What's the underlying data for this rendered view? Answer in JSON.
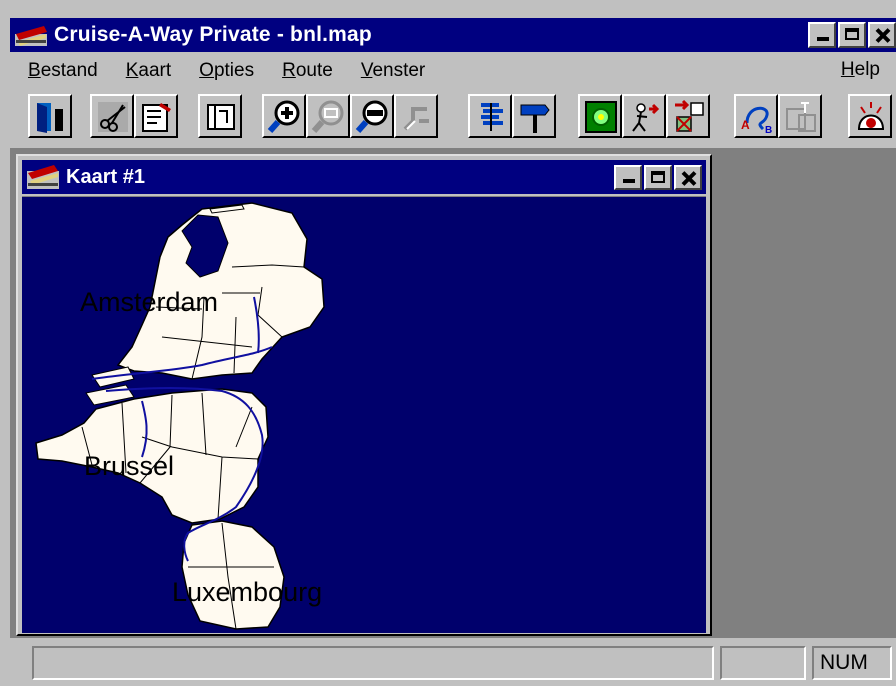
{
  "app": {
    "title": "Cruise-A-Way Private - bnl.map",
    "icon": "car-map-icon"
  },
  "menu": {
    "items": [
      {
        "u": "B",
        "rest": "estand"
      },
      {
        "u": "K",
        "rest": "aart"
      },
      {
        "u": "O",
        "rest": "pties"
      },
      {
        "u": "R",
        "rest": "oute"
      },
      {
        "u": "V",
        "rest": "enster"
      }
    ],
    "help": {
      "u": "H",
      "rest": "elp"
    }
  },
  "toolbar": {
    "buttons": [
      "door-exit-icon",
      "scissors-icon",
      "edit-map-icon",
      "frame-icon",
      "zoom-in-icon",
      "zoom-region-icon",
      "zoom-out-icon",
      "zoom-previous-icon",
      "route-list-icon",
      "signpost-icon",
      "plan-route-icon",
      "walk-route-icon",
      "route-flag-icon",
      "route-ab-icon",
      "route-map-icon",
      "alarm-icon"
    ],
    "disabled": [
      "zoom-region-icon",
      "zoom-previous-icon",
      "route-map-icon"
    ]
  },
  "child_window": {
    "title": "Kaart #1",
    "icon": "map-window-icon",
    "labels": {
      "amsterdam": "Amsterdam",
      "brussel": "Brussel",
      "luxembourg": "Luxembourg"
    }
  },
  "statusbar": {
    "panel1": "",
    "panel2": "",
    "num": "NUM"
  },
  "colors": {
    "titlebar": "#000080",
    "map_sea": "#00006c",
    "land": "#fffaf0",
    "borders": "#000000",
    "rivers": "#1010a0"
  }
}
